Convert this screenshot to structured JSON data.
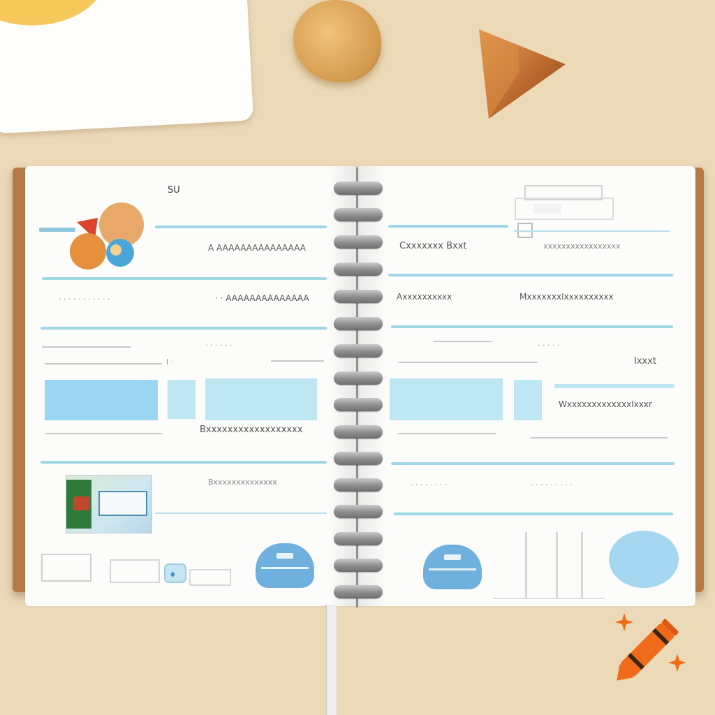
{
  "scene": {
    "colors": {
      "tabletop": "#ecd9b7",
      "page": "#fcfcfb",
      "cover": "#b47a45",
      "accent_blue": "#9ad6ef",
      "card_yellow": "#f6c95a",
      "crayon_orange": "#ef6b1a"
    },
    "objects": {
      "card_icon": "yellow-blob",
      "wood_block_icon": "wood-cylinder-icon",
      "wood_wedge_icon": "wood-triangle-icon",
      "crayon_icon": "crayon-icon",
      "sparkle_icon": "sparkle-icon",
      "balls_icon": "balls-cluster-icon"
    }
  },
  "notebook": {
    "left_page": {
      "corner_label": "SU",
      "row1_text": "A AAAAAAAAAAAAAAA",
      "row2_left": "· · · · · · · · · · ·",
      "row2_right": "· · AAAAAAAAAAAAAA",
      "row3_text": "· · · · · ·",
      "row4_right": "I ·",
      "row5_text": "Bxxxxxxxxxxxxxxxxxx",
      "row6_text": "Bxxxxxxxxxxxxxx"
    },
    "right_page": {
      "row1_left": "Cxxxxxxx Bxxt",
      "row1_right": "xxxxxxxxxxxxxxxxx",
      "row2_left": "Axxxxxxxxxx",
      "row2_right": "MxxxxxxxIxxxxxxxxxx",
      "row3_text": "· · · · ·",
      "row4_right": "Ixxxt",
      "row5_text": "WxxxxxxxxxxxxxIxxxr",
      "row6_left": "· · · · · · · ·",
      "row6_right": "· · · · · · · · ·"
    }
  }
}
